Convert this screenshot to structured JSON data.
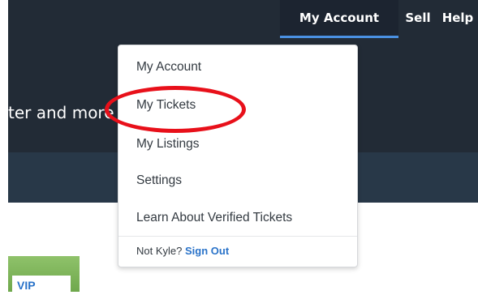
{
  "nav": {
    "account_label": "My Account",
    "sell_label": "Sell",
    "help_label": "Help"
  },
  "hero": {
    "partial_text": "ter and more"
  },
  "account_menu": {
    "items": [
      {
        "label": "My Account"
      },
      {
        "label": "My Tickets"
      },
      {
        "label": "My Listings"
      },
      {
        "label": "Settings"
      },
      {
        "label": "Learn About Verified Tickets"
      }
    ],
    "footer": {
      "prefix": "Not Kyle?",
      "signout_label": "Sign Out"
    }
  },
  "card": {
    "badge_label": "VIP"
  },
  "colors": {
    "header_dark": "#222b36",
    "accent_blue": "#2a73c9",
    "annotation_red": "#e8101a",
    "vip_green": "#7db55a"
  }
}
